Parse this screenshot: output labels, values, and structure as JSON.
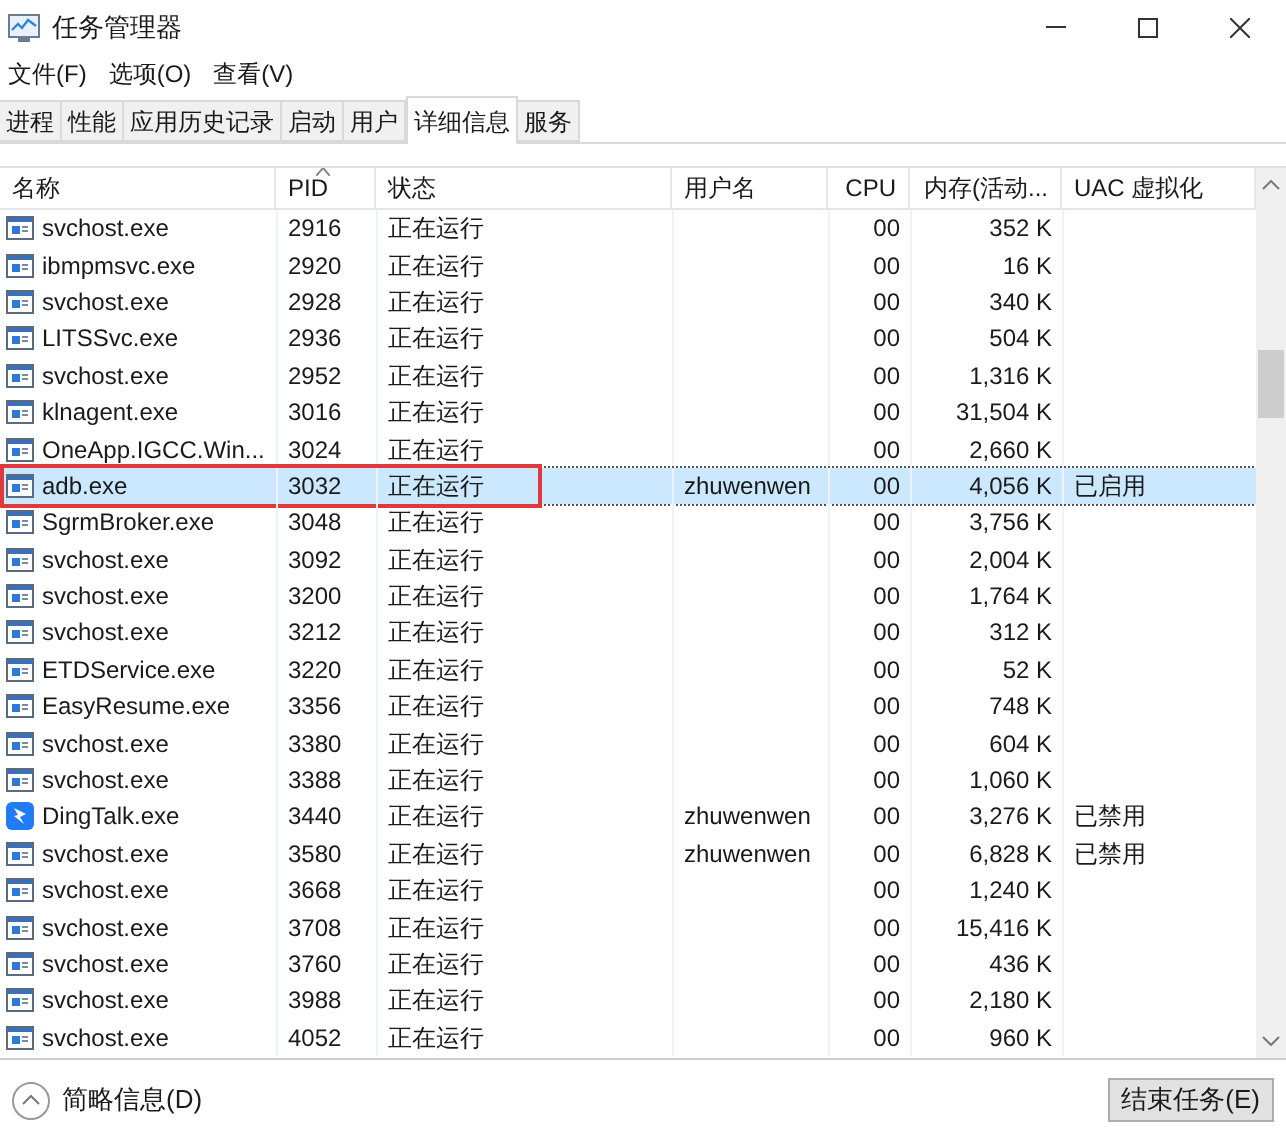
{
  "window": {
    "title": "任务管理器"
  },
  "menu": [
    "文件(F)",
    "选项(O)",
    "查看(V)"
  ],
  "tabs": [
    {
      "label": "进程",
      "selected": false
    },
    {
      "label": "性能",
      "selected": false
    },
    {
      "label": "应用历史记录",
      "selected": false
    },
    {
      "label": "启动",
      "selected": false
    },
    {
      "label": "用户",
      "selected": false
    },
    {
      "label": "详细信息",
      "selected": true
    },
    {
      "label": "服务",
      "selected": false
    }
  ],
  "table": {
    "columns": [
      {
        "label": "名称",
        "sorted": false
      },
      {
        "label": "PID",
        "sorted": true
      },
      {
        "label": "状态",
        "sorted": false
      },
      {
        "label": "用户名",
        "sorted": false
      },
      {
        "label": "CPU",
        "sorted": false
      },
      {
        "label": "内存(活动...",
        "sorted": false
      },
      {
        "label": "UAC 虚拟化",
        "sorted": false
      }
    ],
    "rows": [
      {
        "kind": "app",
        "cells": [
          "svchost.exe",
          "2916",
          "正在运行",
          "",
          "00",
          "352 K",
          ""
        ],
        "selected": false,
        "marked": false
      },
      {
        "kind": "app",
        "cells": [
          "ibmpmsvc.exe",
          "2920",
          "正在运行",
          "",
          "00",
          "16 K",
          ""
        ],
        "selected": false,
        "marked": false
      },
      {
        "kind": "app",
        "cells": [
          "svchost.exe",
          "2928",
          "正在运行",
          "",
          "00",
          "340 K",
          ""
        ],
        "selected": false,
        "marked": false
      },
      {
        "kind": "app",
        "cells": [
          "LITSSvc.exe",
          "2936",
          "正在运行",
          "",
          "00",
          "504 K",
          ""
        ],
        "selected": false,
        "marked": false
      },
      {
        "kind": "app",
        "cells": [
          "svchost.exe",
          "2952",
          "正在运行",
          "",
          "00",
          "1,316 K",
          ""
        ],
        "selected": false,
        "marked": false
      },
      {
        "kind": "app",
        "cells": [
          "klnagent.exe",
          "3016",
          "正在运行",
          "",
          "00",
          "31,504 K",
          ""
        ],
        "selected": false,
        "marked": false
      },
      {
        "kind": "app",
        "cells": [
          "OneApp.IGCC.Win...",
          "3024",
          "正在运行",
          "",
          "00",
          "2,660 K",
          ""
        ],
        "selected": false,
        "marked": false
      },
      {
        "kind": "app",
        "cells": [
          "adb.exe",
          "3032",
          "正在运行",
          "zhuwenwen",
          "00",
          "4,056 K",
          "已启用"
        ],
        "selected": true,
        "marked": true
      },
      {
        "kind": "app",
        "cells": [
          "SgrmBroker.exe",
          "3048",
          "正在运行",
          "",
          "00",
          "3,756 K",
          ""
        ],
        "selected": false,
        "marked": false
      },
      {
        "kind": "app",
        "cells": [
          "svchost.exe",
          "3092",
          "正在运行",
          "",
          "00",
          "2,004 K",
          ""
        ],
        "selected": false,
        "marked": false
      },
      {
        "kind": "app",
        "cells": [
          "svchost.exe",
          "3200",
          "正在运行",
          "",
          "00",
          "1,764 K",
          ""
        ],
        "selected": false,
        "marked": false
      },
      {
        "kind": "app",
        "cells": [
          "svchost.exe",
          "3212",
          "正在运行",
          "",
          "00",
          "312 K",
          ""
        ],
        "selected": false,
        "marked": false
      },
      {
        "kind": "app",
        "cells": [
          "ETDService.exe",
          "3220",
          "正在运行",
          "",
          "00",
          "52 K",
          ""
        ],
        "selected": false,
        "marked": false
      },
      {
        "kind": "app",
        "cells": [
          "EasyResume.exe",
          "3356",
          "正在运行",
          "",
          "00",
          "748 K",
          ""
        ],
        "selected": false,
        "marked": false
      },
      {
        "kind": "app",
        "cells": [
          "svchost.exe",
          "3380",
          "正在运行",
          "",
          "00",
          "604 K",
          ""
        ],
        "selected": false,
        "marked": false
      },
      {
        "kind": "app",
        "cells": [
          "svchost.exe",
          "3388",
          "正在运行",
          "",
          "00",
          "1,060 K",
          ""
        ],
        "selected": false,
        "marked": false
      },
      {
        "kind": "dingtalk",
        "cells": [
          "DingTalk.exe",
          "3440",
          "正在运行",
          "zhuwenwen",
          "00",
          "3,276 K",
          "已禁用"
        ],
        "selected": false,
        "marked": false
      },
      {
        "kind": "app",
        "cells": [
          "svchost.exe",
          "3580",
          "正在运行",
          "zhuwenwen",
          "00",
          "6,828 K",
          "已禁用"
        ],
        "selected": false,
        "marked": false
      },
      {
        "kind": "app",
        "cells": [
          "svchost.exe",
          "3668",
          "正在运行",
          "",
          "00",
          "1,240 K",
          ""
        ],
        "selected": false,
        "marked": false
      },
      {
        "kind": "app",
        "cells": [
          "svchost.exe",
          "3708",
          "正在运行",
          "",
          "00",
          "15,416 K",
          ""
        ],
        "selected": false,
        "marked": false
      },
      {
        "kind": "app",
        "cells": [
          "svchost.exe",
          "3760",
          "正在运行",
          "",
          "00",
          "436 K",
          ""
        ],
        "selected": false,
        "marked": false
      },
      {
        "kind": "app",
        "cells": [
          "svchost.exe",
          "3988",
          "正在运行",
          "",
          "00",
          "2,180 K",
          ""
        ],
        "selected": false,
        "marked": false
      },
      {
        "kind": "app",
        "cells": [
          "svchost.exe",
          "4052",
          "正在运行",
          "",
          "00",
          "960 K",
          ""
        ],
        "selected": false,
        "marked": false
      }
    ]
  },
  "footer": {
    "details_toggle": "简略信息(D)",
    "end_task_button": "结束任务(E)"
  }
}
